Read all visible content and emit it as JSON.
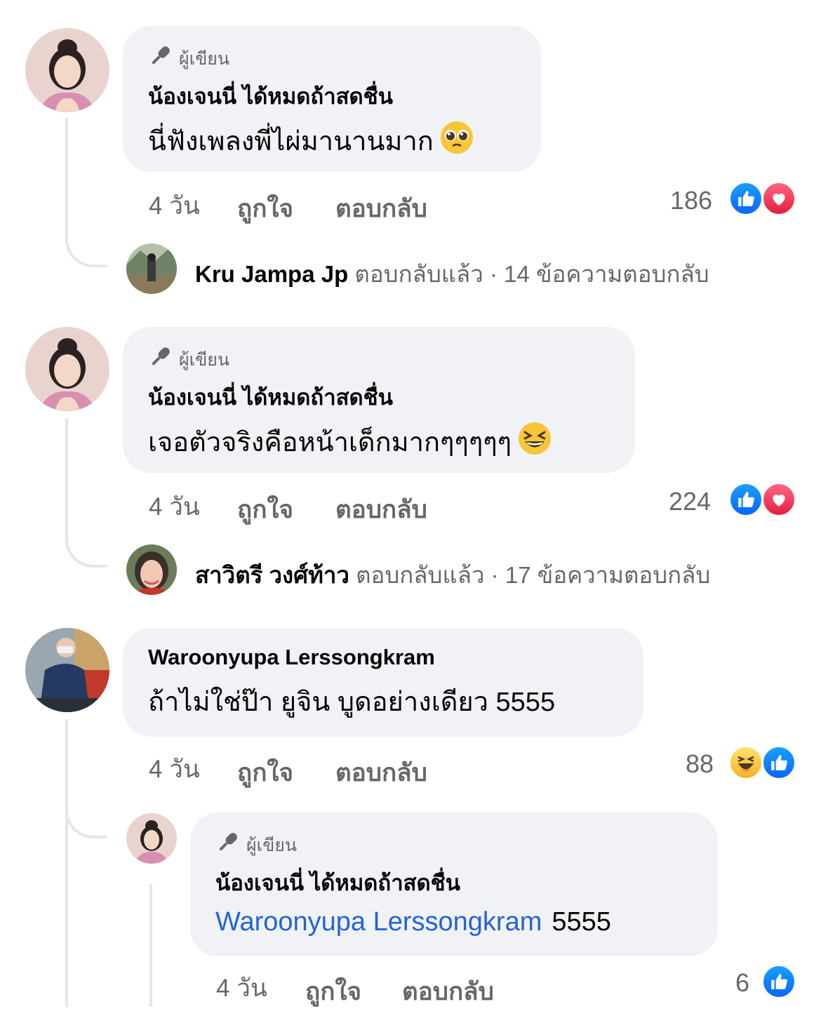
{
  "author_label": "ผู้เขียน",
  "actions": {
    "like": "ถูกใจ",
    "reply": "ตอบกลับ"
  },
  "replied_suffix": "ตอบกลับแล้ว",
  "separator": "·",
  "colors": {
    "like_blue": "#0866ff",
    "love_red": "#e41e3f",
    "haha_yellow": "#f7b125",
    "link_blue": "#2563d7"
  },
  "comments": [
    {
      "name": "น้องเจนนี่ ได้หมดถ้าสดชื่น",
      "is_author": true,
      "text": "นี่ฟังเพลงพี่ไผ่มานานมาก",
      "emoji": "pleading-face",
      "time": "4 วัน",
      "reaction_count": "186",
      "reactions": [
        "like",
        "love"
      ],
      "reply_summary": {
        "name": "Kru Jampa Jp",
        "count_text": "14 ข้อความตอบกลับ"
      }
    },
    {
      "name": "น้องเจนนี่ ได้หมดถ้าสดชื่น",
      "is_author": true,
      "text": "เจอตัวจริงคือหน้าเด็กมากๆๆๆๆๆ",
      "emoji": "grinning-squinting-face",
      "time": "4 วัน",
      "reaction_count": "224",
      "reactions": [
        "like",
        "love"
      ],
      "reply_summary": {
        "name": "สาวิตรี วงศ์ท้าว",
        "count_text": "17 ข้อความตอบกลับ"
      }
    },
    {
      "name": "Waroonyupa Lerssongkram",
      "is_author": false,
      "text": "ถ้าไม่ใช่ป๊า ยูจิน บูดอย่างเดียว 5555",
      "time": "4 วัน",
      "reaction_count": "88",
      "reactions": [
        "haha",
        "like"
      ],
      "reply": {
        "name": "น้องเจนนี่ ได้หมดถ้าสดชื่น",
        "is_author": true,
        "mention": "Waroonyupa Lerssongkram",
        "text": "5555",
        "time": "4 วัน",
        "reaction_count": "6",
        "reactions": [
          "like"
        ]
      }
    }
  ]
}
